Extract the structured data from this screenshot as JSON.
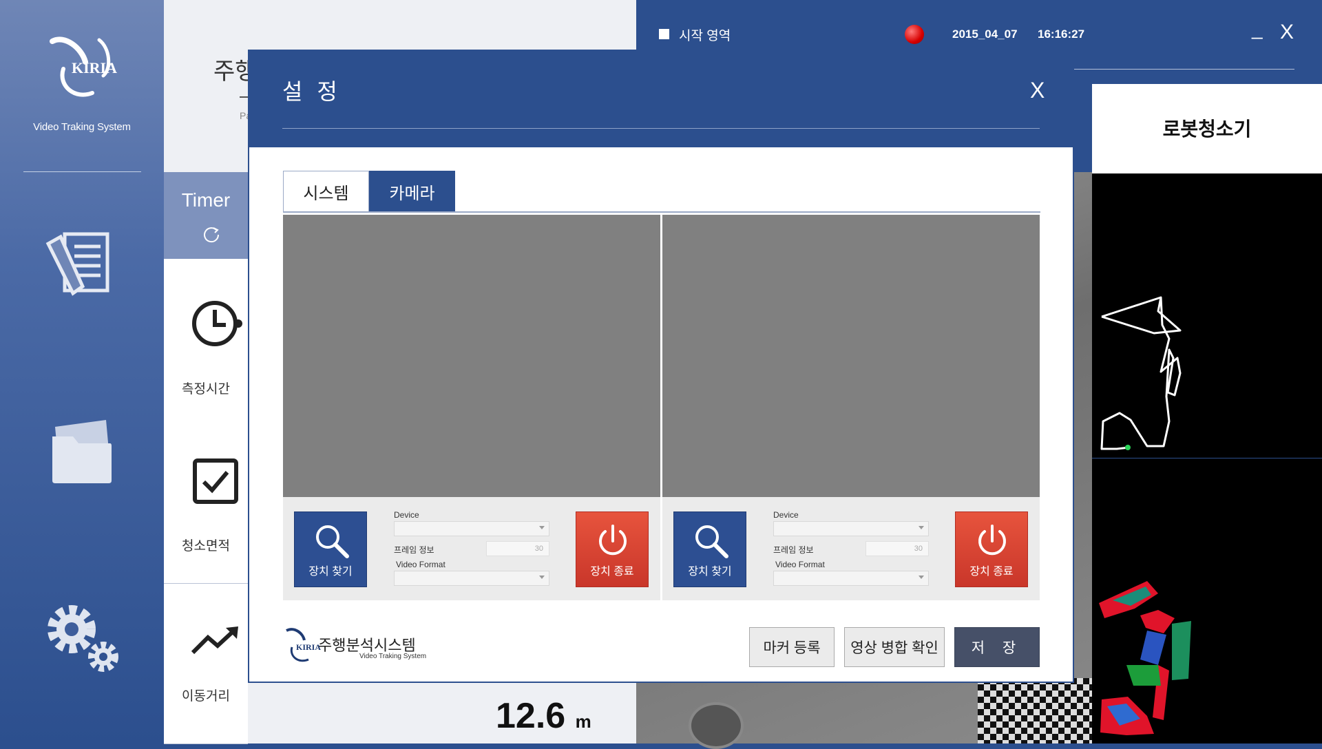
{
  "sidebar": {
    "brand": "KIRIA",
    "subtitle": "Video Traking System",
    "icons": [
      "report-icon",
      "folder-icon",
      "settings-gears-icon"
    ]
  },
  "background": {
    "page_title_partial": "주행",
    "subtitle_partial": "Pa",
    "timer_label": "Timer",
    "tiles": [
      {
        "label": "측정시간",
        "icon": "clock-icon"
      },
      {
        "label": "청소면적",
        "icon": "checkbox-icon"
      },
      {
        "label": "이동거리",
        "icon": "trend-up-icon"
      }
    ],
    "distance_value": "12.6",
    "distance_unit": "m"
  },
  "topbar": {
    "start_area_label": "시작 영역",
    "date": "2015_04_07",
    "time": "16:16:27",
    "minimize": "_",
    "close": "X"
  },
  "right_panel": {
    "title": "로봇청소기"
  },
  "modal": {
    "title": "설 정",
    "close": "X",
    "tabs": [
      {
        "label": "시스템",
        "active": false
      },
      {
        "label": "카메라",
        "active": true
      }
    ],
    "cameras": [
      {
        "find_button": "장치 찾기",
        "device_label": "Device",
        "frame_label": "프레임 정보",
        "frame_value": "30",
        "format_label": "Video Format",
        "stop_button": "장치 종료"
      },
      {
        "find_button": "장치 찾기",
        "device_label": "Device",
        "frame_label": "프레임 정보",
        "frame_value": "30",
        "format_label": "Video Format",
        "stop_button": "장치 종료"
      }
    ],
    "footer": {
      "brand_logo": "KIRIA",
      "brand_name": "주행분석시스템",
      "brand_sub": "Video Traking System",
      "marker_button": "마커 등록",
      "merge_button": "영상 병합 확인",
      "save_button": "저 장"
    }
  },
  "colors": {
    "primary": "#2c4f8e",
    "stop_red": "#d8432f",
    "save_dark": "#465068"
  }
}
